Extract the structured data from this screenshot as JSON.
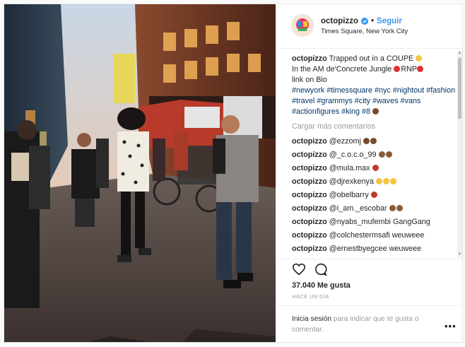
{
  "post": {
    "username": "octopizzo",
    "follow_label": "Seguir",
    "location": "Times Square, New York City",
    "caption": {
      "username": "octopizzo",
      "text_line1": "Trapped out in a COUPE",
      "text_line2_a": "In the AM de'Concrete Jungle",
      "text_line2_b": "RNP",
      "text_line3": "link on Bio",
      "hashtags": "#newyork #timessquare #nyc #nightout #fashion #travel #grammys #city #waves #vans #actionfigures #king #8"
    },
    "load_more": "Cargar más comentarios",
    "comments": [
      {
        "user": "octopizzo",
        "text": "@ezzomj",
        "emoji": [
          "#7a4a2a",
          "#7a4a2a"
        ]
      },
      {
        "user": "octopizzo",
        "text": "@_c.o.c.o_99",
        "emoji": [
          "#8a5a35",
          "#8a5a35"
        ]
      },
      {
        "user": "octopizzo",
        "text": "@mula.max",
        "emoji": [
          "#c0392b"
        ]
      },
      {
        "user": "octopizzo",
        "text": "@djrexkenya",
        "emoji": [
          "#f4c542",
          "#f4c542",
          "#f4c542"
        ]
      },
      {
        "user": "octopizzo",
        "text": "@obelbarry",
        "emoji": [
          "#c0392b"
        ]
      },
      {
        "user": "octopizzo",
        "text": "@i_am._escobar",
        "emoji": [
          "#8a5a35",
          "#8a5a35"
        ]
      },
      {
        "user": "octopizzo",
        "text": "@nyabs_mufembi GangGang",
        "emoji": []
      },
      {
        "user": "octopizzo",
        "text": "@colchestermsafi weuweee",
        "emoji": []
      },
      {
        "user": "octopizzo",
        "text": "@ernestbyegcee weuweee",
        "emoji": []
      }
    ],
    "likes": "37.040 Me gusta",
    "timestamp": "HACE UN DÍA",
    "login_link": "Inicia sesión",
    "login_text": "para indicar que te gusta o comentar.",
    "more_label": "•••",
    "icons": {
      "heart": "heart-icon",
      "comment": "comment-icon",
      "verified": "verified-badge-icon",
      "more": "more-options-icon"
    },
    "colors": {
      "link": "#3897f0",
      "hashtag": "#003569",
      "muted": "#999999",
      "text": "#262626"
    }
  }
}
